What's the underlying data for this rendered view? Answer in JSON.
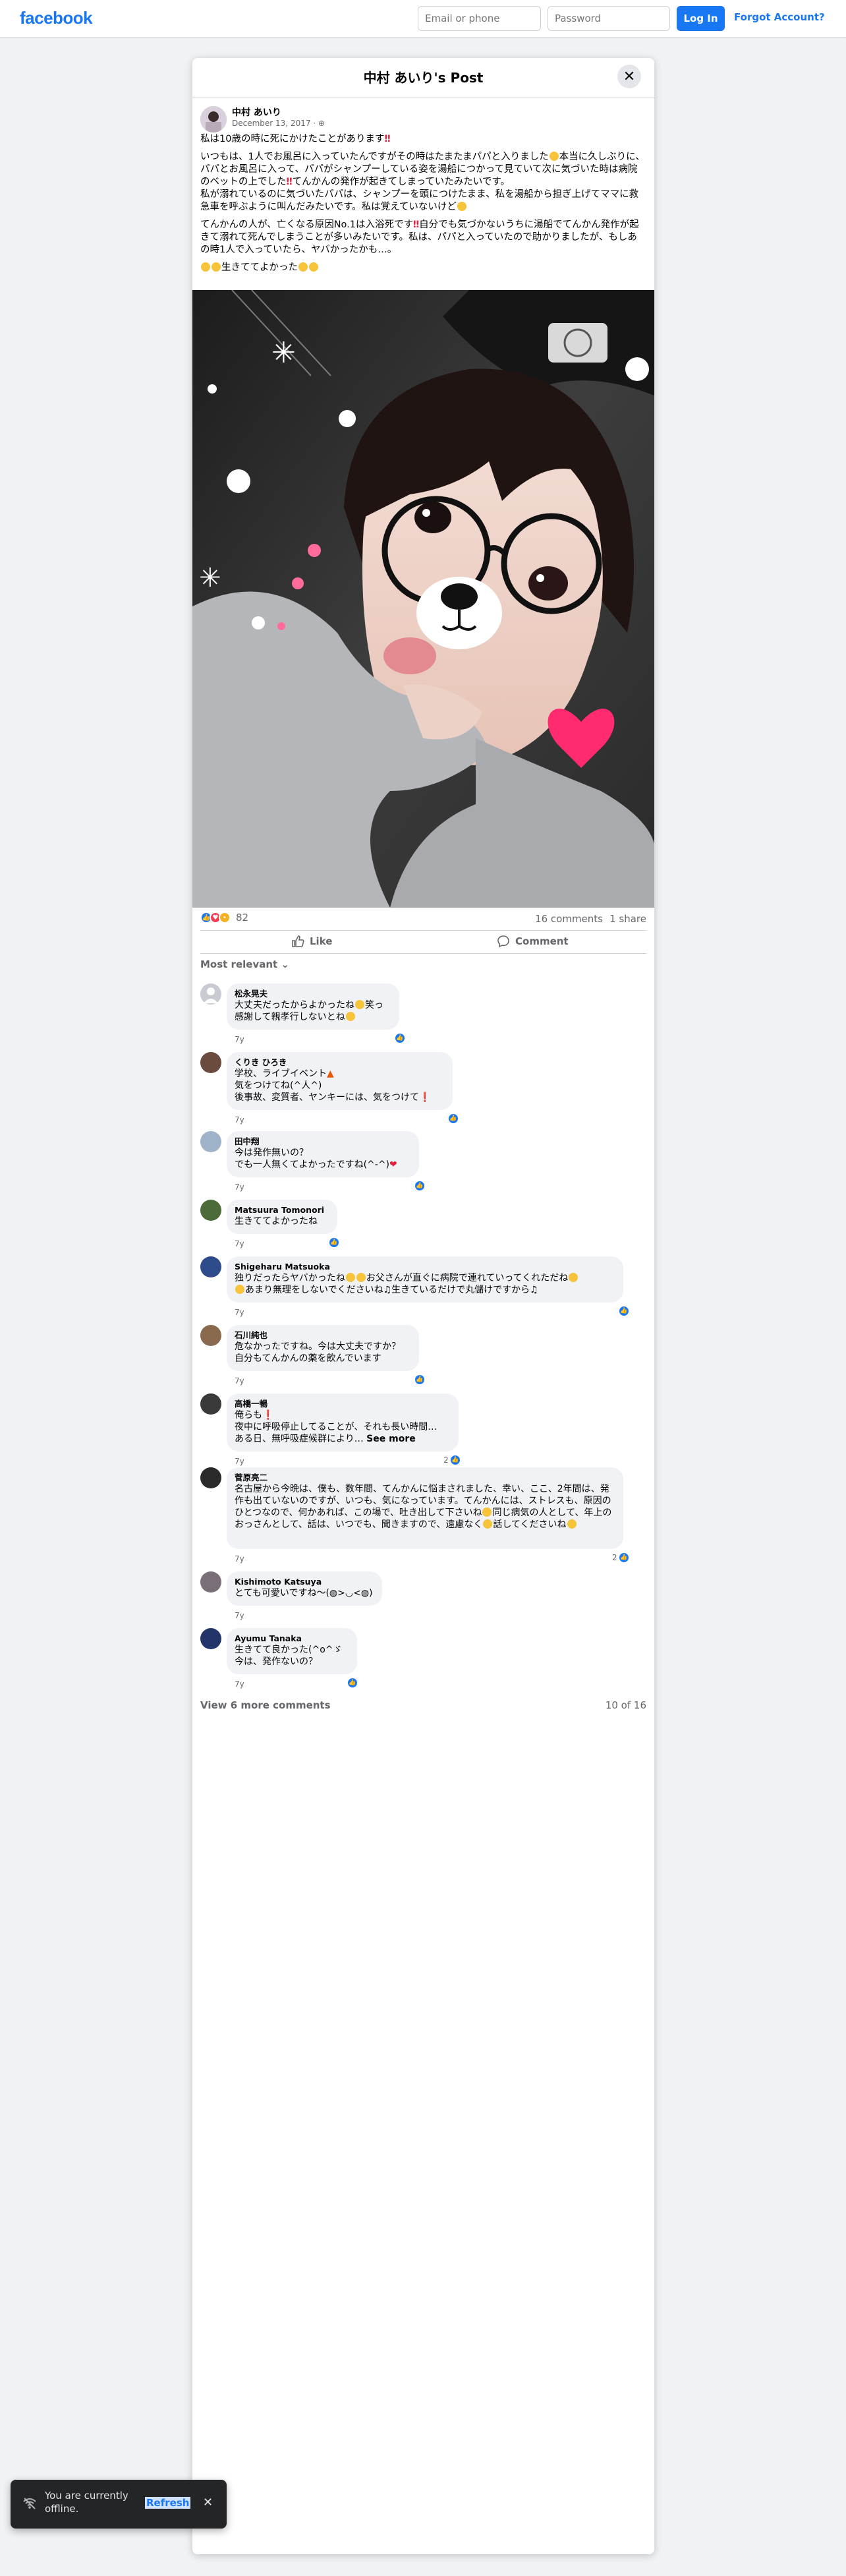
{
  "header": {
    "logo": "facebook",
    "email_placeholder": "Email or phone",
    "password_placeholder": "Password",
    "login_label": "Log In",
    "forgot_label": "Forgot Account?"
  },
  "post": {
    "title": "中村 あいり's Post",
    "author": "中村 あいり",
    "date": "December 13, 2017 · ",
    "p1": "私は10歳の時に死にかけたことがあります",
    "p2a": "いつもは、1人でお風呂に入っていたんですがその時はたまたまパパと入りました",
    "p2b": "本当に久しぶりに、パパとお風呂に入って、パパがシャンプーしている姿を湯船につかって見ていて次に気づいた時は病院のベットの上でした",
    "p2c": "てんかんの発作が起きてしまっていたみたいです。",
    "p2d": "私が溺れているのに気づいたパパは、シャンプーを頭につけたまま、私を湯船から担ぎ上げてママに救急車を呼ぶように叫んだみたいです。私は覚えていないけど",
    "p3a": "てんかんの人が、亡くなる原因No.1は入浴死です",
    "p3b": "自分でも気づかないうちに湯船でてんかん発作が起きて溺れて死んでしまうことが多いみたいです。私は、パパと入っていたので助かりましたが、もしあの時1人で入っていたら、ヤバかったかも…。",
    "p4": "生きててよかった",
    "reaction_count": "82",
    "comments_count": "16 comments",
    "shares_count": "1 share",
    "like_label": "Like",
    "comment_label": "Comment",
    "sort_label": "Most relevant"
  },
  "comments": [
    {
      "name": "松永晃夫",
      "line1": "大丈夫だったからよかったね",
      "line1b": "笑っ",
      "line2": "感謝して親孝行しないとね",
      "time": "7y"
    },
    {
      "name": "くりき ひろき",
      "line1": "学校、ライブイベント",
      "line2": "気をつけてね(^人^)",
      "line3": "後事故、変質者、ヤンキーには、気をつけて",
      "time": "7y"
    },
    {
      "name": "田中翔",
      "line1": "今は発作無いの？",
      "line2": "でも一人無くてよかったですね(^-^)",
      "time": "7y"
    },
    {
      "name": "Matsuura Tomonori",
      "line1": "生きててよかったね",
      "time": "7y"
    },
    {
      "name": "Shigeharu Matsuoka",
      "line1": "独りだったらヤバかったね",
      "line1b": "お父さんが直ぐに病院で連れていってくれただね",
      "line2": "あまり無理をしないでくださいね",
      "line2b": "生きているだけで丸儲けですから",
      "time": "7y"
    },
    {
      "name": "石川純也",
      "line1": "危なかったですね。今は大丈夫ですか？",
      "line2": "自分もてんかんの薬を飲んでいます",
      "time": "7y"
    },
    {
      "name": "高橋一暢",
      "line1": "俺らも",
      "line2": "夜中に呼吸停止してることが、それも長い時間…",
      "line3": "ある日、無呼吸症候群により… ",
      "see_more": "See more",
      "time": "7y",
      "likes": "2"
    },
    {
      "name": "菅原亮二",
      "line1": "名古屋から今晩は、僕も、数年間、てんかんに悩まされました、幸い、ここ、2年間は、発作も出ていないのですが、いつも、気になっています。てんかんには、ストレスも、原因のひとつなので、何かあれば、この場で、吐き出して下さいね",
      "line1b": "同じ病気の人として、年上のおっさんとして、話は、いつでも、聞きますので、遠慮なく",
      "line1c": "話してくださいね",
      "time": "7y",
      "likes": "2"
    },
    {
      "name": "Kishimoto Katsuya",
      "line1": "とても可愛いですね〜(◍>◡<◍)",
      "time": "7y"
    },
    {
      "name": "Ayumu Tanaka",
      "line1": "生きてて良かった(^o^ゞ",
      "line2": "今は、発作ないの？",
      "time": "7y"
    }
  ],
  "footer": {
    "view_more": "View 6 more comments",
    "of_count": "10 of 16"
  },
  "toast": {
    "text": "You are currently offline.",
    "refresh": "Refresh"
  }
}
